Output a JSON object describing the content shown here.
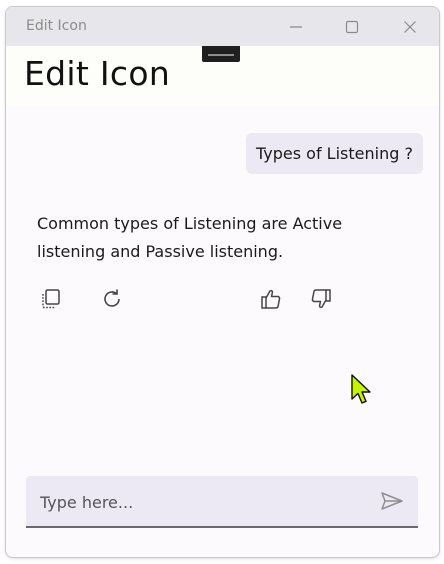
{
  "window": {
    "title": "Edit Icon",
    "minimize_icon": "minimize-icon",
    "maximize_icon": "maximize-icon",
    "close_icon": "close-icon"
  },
  "page": {
    "title": "Edit Icon"
  },
  "chat": {
    "user_message": "Types of Listening ?",
    "bot_message": "Common types of Listening are Active listening and Passive listening.",
    "actions": [
      {
        "icon": "copy-icon"
      },
      {
        "icon": "refresh-icon"
      },
      {
        "icon": "thumbs-up-icon"
      },
      {
        "icon": "thumbs-down-icon"
      }
    ]
  },
  "input": {
    "placeholder": "Type here...",
    "value": "",
    "send_icon": "send-icon"
  },
  "colors": {
    "titlebar": "#e7e6ea",
    "background": "#fcfafd",
    "bubble": "#ece9f5",
    "cursor": "#c6f400"
  }
}
